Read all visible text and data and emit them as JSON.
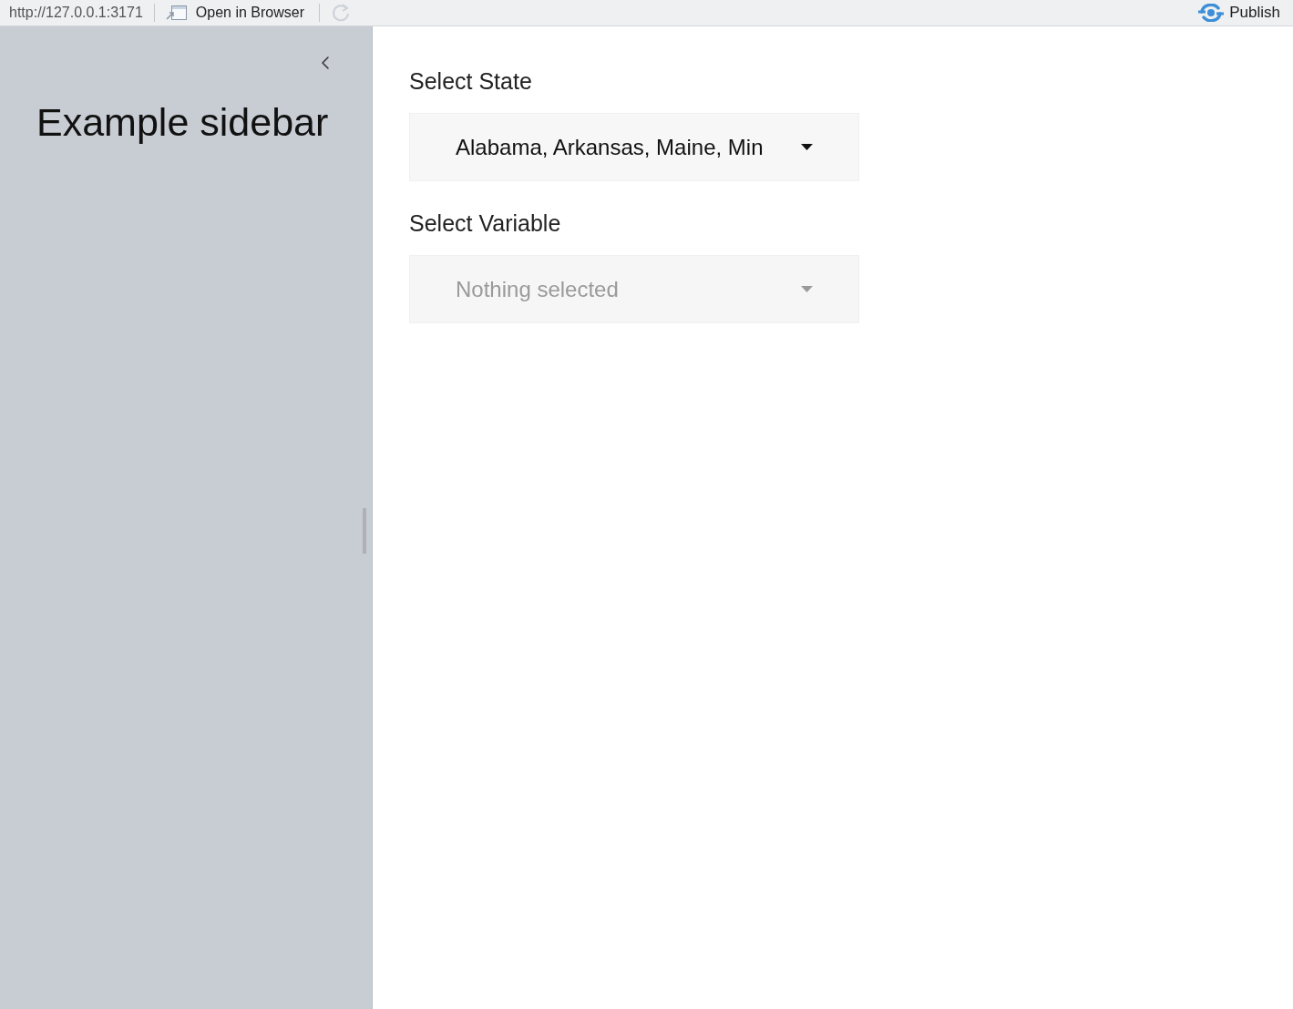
{
  "toolbar": {
    "url": "http://127.0.0.1:3171",
    "open_in_browser": "Open in Browser",
    "refresh": {
      "disabled": true
    },
    "publish": "Publish"
  },
  "sidebar": {
    "title": "Example sidebar"
  },
  "inputs": [
    {
      "label": "Select State",
      "value": "Alabama, Arkansas, Maine, Min",
      "disabled": false
    },
    {
      "label": "Select Variable",
      "placeholder": "Nothing selected",
      "disabled": true
    }
  ]
}
